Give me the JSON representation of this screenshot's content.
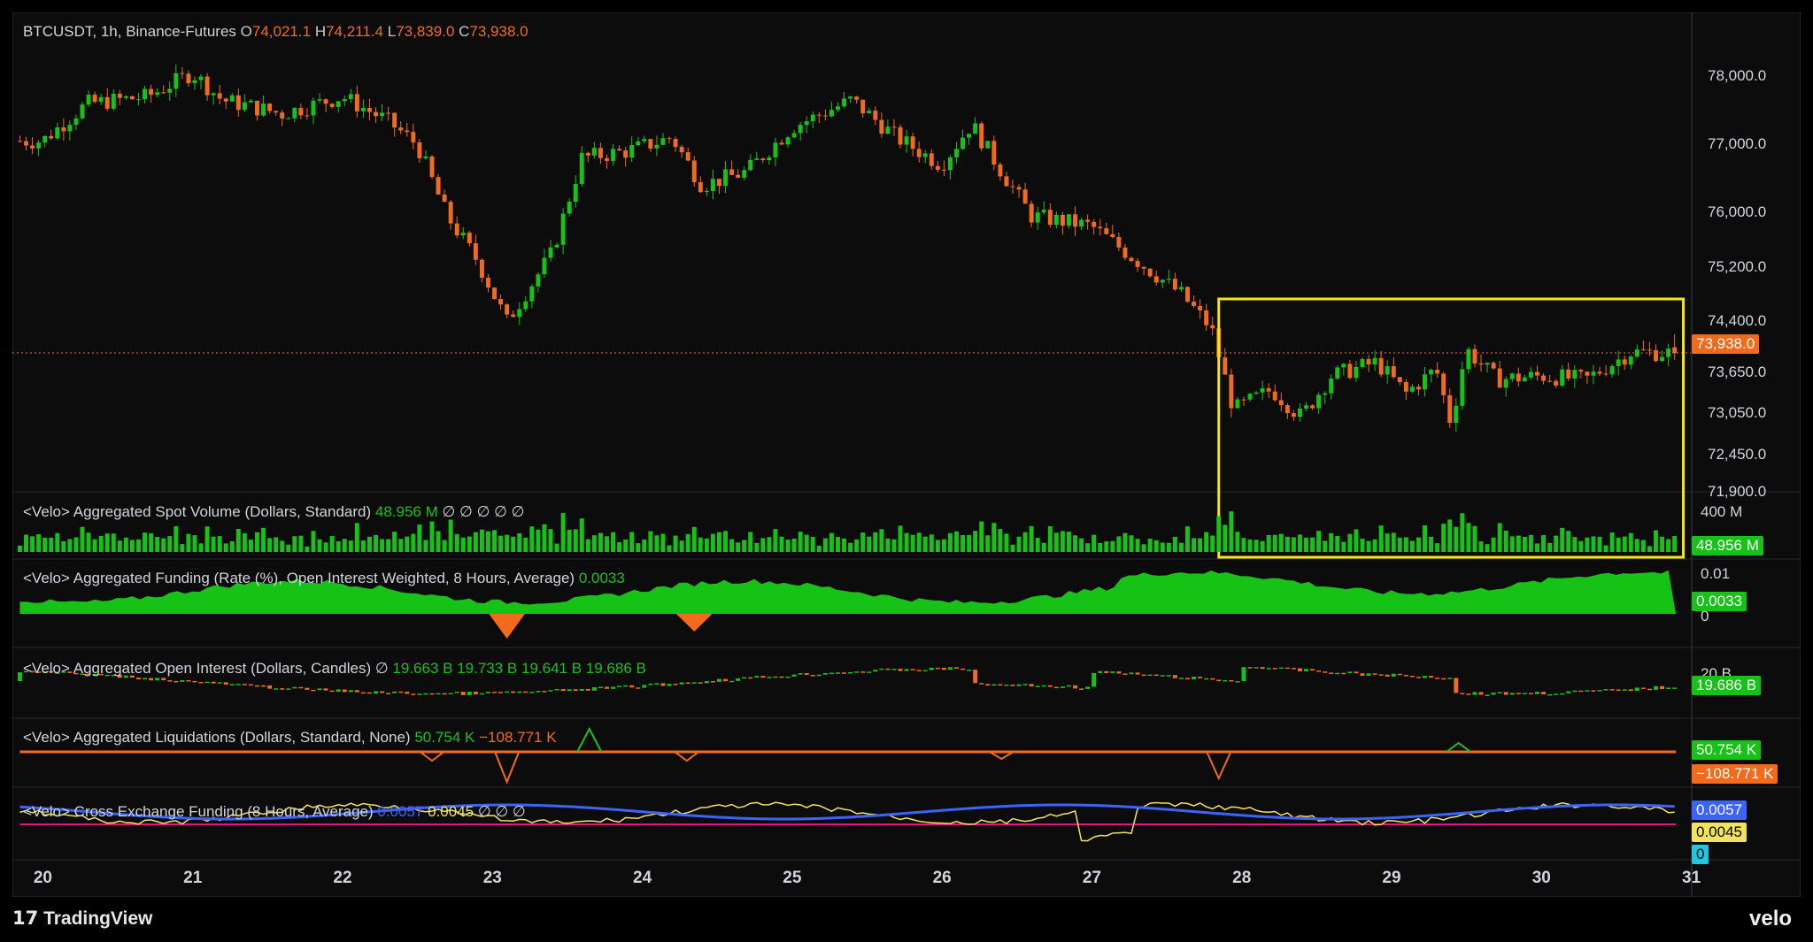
{
  "header": {
    "symbol": "BTCUSDT, 1h, Binance-Futures",
    "open_label": "O",
    "open": "74,021.1",
    "high_label": "H",
    "high": "74,211.4",
    "low_label": "L",
    "low": "73,839.0",
    "close_label": "C",
    "close": "73,938.0"
  },
  "panes": {
    "spot_volume": {
      "title": "<Velo> Aggregated Spot Volume (Dollars, Standard)",
      "value": "48.956 M",
      "nulls": "∅ ∅ ∅ ∅ ∅",
      "axis_label": "400 M",
      "tag": "48.956 M"
    },
    "funding": {
      "title": "<Velo> Aggregated Funding (Rate (%), Open Interest Weighted, 8 Hours, Average)",
      "value": "0.0033",
      "axis_top": "0.01",
      "axis_zero": "0",
      "tag": "0.0033"
    },
    "open_interest": {
      "title": "<Velo> Aggregated Open Interest (Dollars, Candles)",
      "null": "∅",
      "o": "19.663 B",
      "h": "19.733 B",
      "l": "19.641 B",
      "c": "19.686 B",
      "axis_label": "20 B",
      "tag": "19.686 B"
    },
    "liquidations": {
      "title": "<Velo> Aggregated Liquidations (Dollars, Standard, None)",
      "long": "50.754 K",
      "short": "−108.771 K",
      "tag_long": "50.754 K",
      "tag_short": "−108.771 K"
    },
    "cross_funding": {
      "title": "<Velo> Cross Exchange Funding (8 Hours, Average)",
      "v1": "0.0057",
      "v2": "0.0045",
      "nulls": "∅ ∅ ∅",
      "tag1": "0.0057",
      "tag2": "0.0045",
      "tag3": "0"
    }
  },
  "price_axis": {
    "ticks": [
      "78,000.0",
      "77,000.0",
      "76,000.0",
      "75,200.0",
      "74,400.0",
      "73,650.0",
      "73,050.0",
      "72,450.0",
      "71,900.0"
    ],
    "last_price_tag": "73,938.0"
  },
  "x_axis": {
    "ticks": [
      "20",
      "21",
      "22",
      "23",
      "24",
      "25",
      "26",
      "27",
      "28",
      "29",
      "30",
      "31"
    ]
  },
  "branding": {
    "tradingview": "TradingView",
    "velo": "velo"
  },
  "colors": {
    "up": "#16c216",
    "down": "#f26b1d",
    "highlight_box": "#f5e614",
    "blue": "#3d63ff",
    "yellow": "#f3e25c",
    "magenta": "#e5177a",
    "cyan": "#1ec8e0"
  },
  "chart_data": {
    "type": "candlestick",
    "title": "BTCUSDT, 1h, Binance-Futures",
    "x_unit": "day of month",
    "x_range": [
      19.8,
      31.0
    ],
    "ylim": [
      71900,
      78600
    ],
    "price_path_approx": [
      {
        "x": 20.0,
        "y": 77050
      },
      {
        "x": 20.3,
        "y": 77600
      },
      {
        "x": 20.7,
        "y": 77700
      },
      {
        "x": 21.0,
        "y": 78050
      },
      {
        "x": 21.2,
        "y": 77650
      },
      {
        "x": 21.6,
        "y": 77450
      },
      {
        "x": 22.0,
        "y": 77700
      },
      {
        "x": 22.3,
        "y": 77350
      },
      {
        "x": 22.5,
        "y": 77000
      },
      {
        "x": 22.7,
        "y": 75950
      },
      {
        "x": 22.9,
        "y": 75300
      },
      {
        "x": 23.1,
        "y": 74400
      },
      {
        "x": 23.4,
        "y": 75400
      },
      {
        "x": 23.6,
        "y": 76800
      },
      {
        "x": 23.9,
        "y": 76900
      },
      {
        "x": 24.2,
        "y": 77100
      },
      {
        "x": 24.4,
        "y": 76400
      },
      {
        "x": 24.7,
        "y": 76600
      },
      {
        "x": 25.0,
        "y": 77250
      },
      {
        "x": 25.4,
        "y": 77650
      },
      {
        "x": 25.7,
        "y": 77100
      },
      {
        "x": 26.0,
        "y": 76700
      },
      {
        "x": 26.2,
        "y": 77300
      },
      {
        "x": 26.4,
        "y": 76600
      },
      {
        "x": 26.6,
        "y": 75950
      },
      {
        "x": 27.0,
        "y": 75800
      },
      {
        "x": 27.3,
        "y": 75300
      },
      {
        "x": 27.6,
        "y": 74800
      },
      {
        "x": 27.8,
        "y": 74300
      },
      {
        "x": 27.95,
        "y": 73100
      },
      {
        "x": 28.2,
        "y": 73400
      },
      {
        "x": 28.4,
        "y": 73000
      },
      {
        "x": 28.6,
        "y": 73600
      },
      {
        "x": 28.9,
        "y": 73800
      },
      {
        "x": 29.1,
        "y": 73350
      },
      {
        "x": 29.3,
        "y": 73700
      },
      {
        "x": 29.4,
        "y": 72900
      },
      {
        "x": 29.5,
        "y": 74000
      },
      {
        "x": 29.7,
        "y": 73550
      },
      {
        "x": 30.0,
        "y": 73600
      },
      {
        "x": 30.3,
        "y": 73550
      },
      {
        "x": 30.6,
        "y": 73950
      },
      {
        "x": 30.9,
        "y": 73938
      }
    ],
    "last_price": 73938.0,
    "ohlc_last": {
      "open": 74021.1,
      "high": 74211.4,
      "low": 73839.0,
      "close": 73938.0
    }
  }
}
